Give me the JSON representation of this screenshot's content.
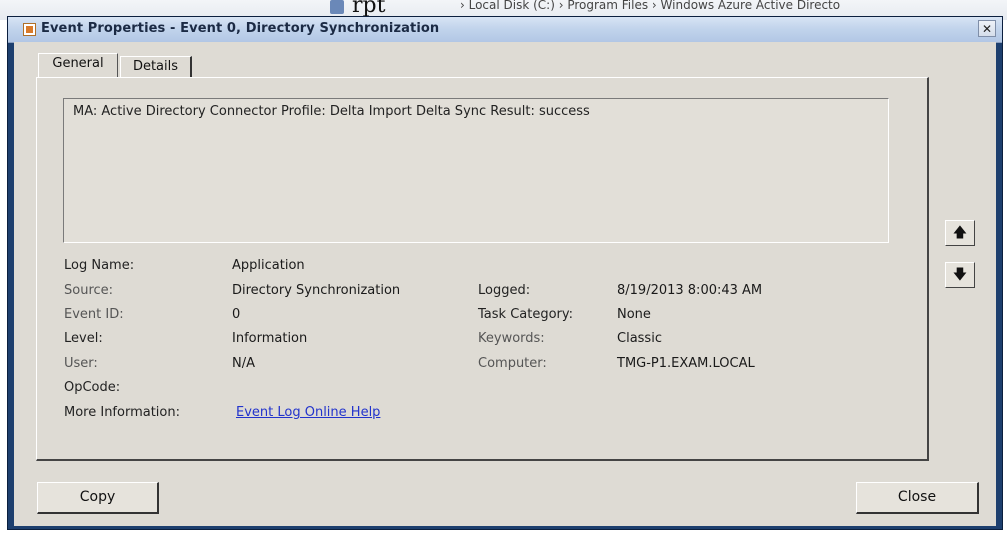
{
  "background": {
    "text_fragment": "rpt",
    "path_fragment": "› Local Disk (C:) › Program Files › Windows Azure Active Directo"
  },
  "window": {
    "title": "Event Properties - Event 0, Directory Synchronization",
    "close_glyph": "✕"
  },
  "tabs": {
    "general": "General",
    "details": "Details"
  },
  "description": "MA: Active Directory Connector Profile: Delta Import Delta Sync Result: success",
  "fields": {
    "log_name": {
      "label": "Log Name:",
      "value": "Application"
    },
    "source": {
      "label": "Source:",
      "value": "Directory Synchronization"
    },
    "logged": {
      "label": "Logged:",
      "value": "8/19/2013 8:00:43 AM"
    },
    "event_id": {
      "label": "Event ID:",
      "value": "0"
    },
    "task_category": {
      "label": "Task Category:",
      "value": "None"
    },
    "level": {
      "label": "Level:",
      "value": "Information"
    },
    "keywords": {
      "label": "Keywords:",
      "value": "Classic"
    },
    "user": {
      "label": "User:",
      "value": "N/A"
    },
    "computer": {
      "label": "Computer:",
      "value": "TMG-P1.EXAM.LOCAL"
    },
    "opcode": {
      "label": "OpCode:",
      "value": ""
    },
    "more_info": {
      "label": "More Information:",
      "link": "Event Log Online Help"
    }
  },
  "buttons": {
    "up_glyph": "🡅",
    "down_glyph": "🡇",
    "copy": "Copy",
    "close": "Close"
  },
  "icons": {
    "title": "event-viewer-icon",
    "up": "arrow-up-icon",
    "down": "arrow-down-icon"
  }
}
